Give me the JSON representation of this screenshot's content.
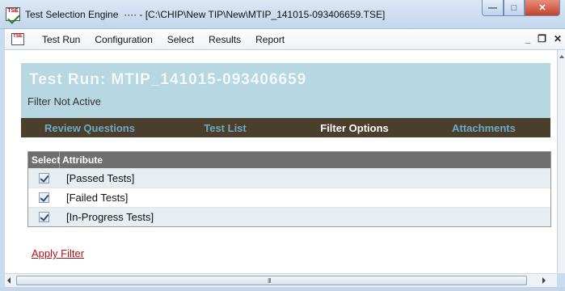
{
  "window": {
    "title": "Test Selection Engine  ···· - [C:\\CHIP\\New TIP\\New\\MTIP_141015-093406659.TSE]",
    "controls": {
      "minimize": "—",
      "maximize": "□",
      "close": "✕"
    }
  },
  "menubar": {
    "items": [
      "Test Run",
      "Configuration",
      "Select",
      "Results",
      "Report"
    ],
    "mdi": {
      "minimize": "_",
      "restore": "❐",
      "close": "✕"
    }
  },
  "header": {
    "run_title": "Test Run: MTIP_141015-093406659",
    "filter_status": "Filter Not Active"
  },
  "tabs": [
    {
      "label": "Review Questions",
      "active": false
    },
    {
      "label": "Test List",
      "active": false
    },
    {
      "label": "Filter Options",
      "active": true
    },
    {
      "label": "Attachments",
      "active": false
    }
  ],
  "grid": {
    "columns": [
      "Select",
      "Attribute"
    ],
    "rows": [
      {
        "checked": true,
        "attribute": "[Passed Tests]"
      },
      {
        "checked": true,
        "attribute": "[Failed Tests]"
      },
      {
        "checked": true,
        "attribute": "[In-Progress Tests]"
      }
    ]
  },
  "apply_link": "Apply Filter",
  "scrollbar": {
    "grip": "III"
  },
  "colors": {
    "header_bg": "#b7d8e3",
    "tabbar_bg": "#4a3f2d",
    "tab_inactive": "#6fa9c4",
    "tab_active": "#ffffff",
    "grid_header_bg": "#6f6f6f",
    "row_alt_bg": "#e6eef2",
    "link_color": "#b0101a"
  }
}
